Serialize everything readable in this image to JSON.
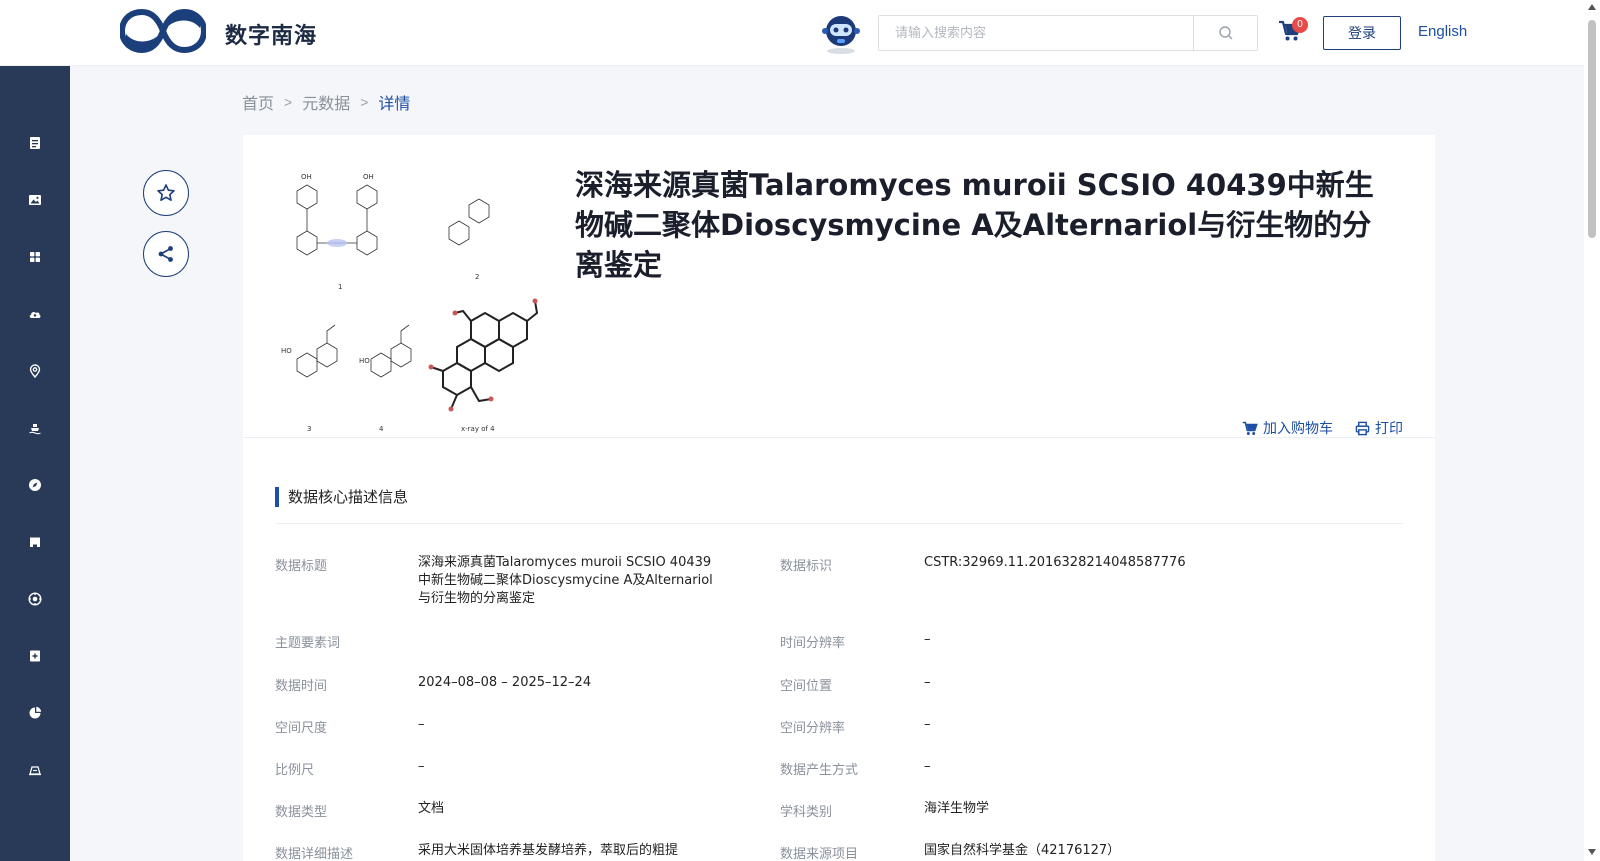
{
  "header": {
    "brand": "数字南海",
    "search_placeholder": "请输入搜索内容",
    "cart_count": "0",
    "login_label": "登录",
    "lang_label": "English"
  },
  "breadcrumb": {
    "home": "首页",
    "metadata": "元数据",
    "current": "详情"
  },
  "sidebar": {
    "icons": [
      "document-icon",
      "image-icon",
      "grid-icon",
      "cloud-icon",
      "location-icon",
      "ship-icon",
      "compass-icon",
      "store-icon",
      "target-icon",
      "plus-icon",
      "chart-icon",
      "map-icon"
    ]
  },
  "record": {
    "title": "深海来源真菌Talaromyces muroii SCSIO 40439中新生物碱二聚体Dioscysmycine A及Alternariol与衍生物的分离鉴定",
    "add_to_cart": "加入购物车",
    "print": "打印",
    "section_title": "数据核心描述信息",
    "fields": {
      "title_label": "数据标题",
      "title_value": "深海来源真菌Talaromyces muroii SCSIO 40439中新生物碱二聚体Dioscysmycine A及Alternariol与衍生物的分离鉴定",
      "id_label": "数据标识",
      "id_value": "CSTR:32969.11.2016328214048587776",
      "keywords_label": "主题要素词",
      "keywords_value": "",
      "time_res_label": "时间分辨率",
      "time_res_value": "–",
      "time_label": "数据时间",
      "time_value": "2024–08–08 – 2025–12–24",
      "space_loc_label": "空间位置",
      "space_loc_value": "–",
      "space_scale_label": "空间尺度",
      "space_scale_value": "–",
      "space_res_label": "空间分辨率",
      "space_res_value": "–",
      "scale_label": "比例尺",
      "scale_value": "–",
      "gen_method_label": "数据产生方式",
      "gen_method_value": "–",
      "type_label": "数据类型",
      "type_value": "文档",
      "subject_label": "学科类别",
      "subject_value": "海洋生物学",
      "desc_label": "数据详细描述",
      "desc_value": "采用大米固体培养基发酵培养，萃取后的粗提",
      "project_label": "数据来源项目",
      "project_value": "国家自然科学基金（42176127）"
    }
  },
  "colors": {
    "sidebar_bg": "#283a58",
    "accent": "#1d4fa3",
    "brand_dark": "#1d3f7a"
  }
}
